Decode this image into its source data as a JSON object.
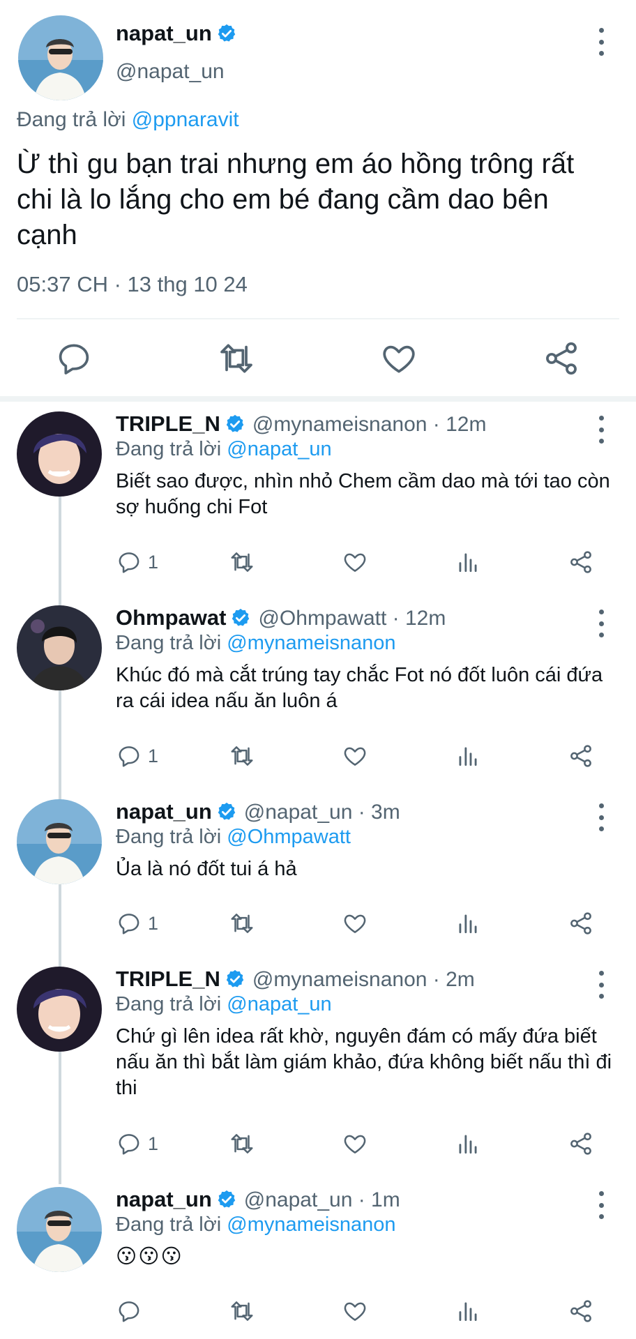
{
  "main_tweet": {
    "name": "napat_un",
    "handle": "@napat_un",
    "reply_prefix": "Đang trả lời",
    "reply_to": "@ppnaravit",
    "text": "Ừ thì gu bạn trai nhưng em áo hồng trông rất chi là lo lắng cho em bé đang cầm dao bên cạnh",
    "timestamp": "05:37 CH · 13 thg 10 24"
  },
  "colors": {
    "accent": "#1d9bf0",
    "text": "#0f1419",
    "muted": "#536471",
    "divider": "#eff3f4"
  },
  "icons": [
    "reply-icon",
    "retweet-icon",
    "like-icon",
    "share-icon",
    "analytics-icon",
    "verified-icon",
    "more-icon"
  ],
  "replies": [
    {
      "name": "TRIPLE_N",
      "handle": "@mynameisnanon · 12m",
      "reply_prefix": "Đang trả lời",
      "reply_to": "@napat_un",
      "text": "Biết sao được, nhìn nhỏ Chem cầm dao mà tới tao còn sợ huống chi Fot",
      "reply_count": "1"
    },
    {
      "name": "Ohmpawat",
      "handle": "@Ohmpawatt · 12m",
      "reply_prefix": "Đang trả lời",
      "reply_to": "@mynameisnanon",
      "text": "Khúc đó mà cắt trúng tay chắc Fot nó đốt luôn cái đứa ra cái idea nấu ăn luôn á",
      "reply_count": "1"
    },
    {
      "name": "napat_un",
      "handle": "@napat_un · 3m",
      "reply_prefix": "Đang trả lời",
      "reply_to": "@Ohmpawatt",
      "text": "Ủa là nó đốt tui á hả",
      "reply_count": "1"
    },
    {
      "name": "TRIPLE_N",
      "handle": "@mynameisnanon · 2m",
      "reply_prefix": "Đang trả lời",
      "reply_to": "@napat_un",
      "text": "Chứ gì lên idea rất khờ, nguyên đám có mấy đứa biết nấu ăn thì bắt làm giám khảo, đứa không biết nấu thì đi thi",
      "reply_count": "1"
    },
    {
      "name": "napat_un",
      "handle": "@napat_un · 1m",
      "reply_prefix": "Đang trả lời",
      "reply_to": "@mynameisnanon",
      "text": "😗😗😗",
      "reply_count": ""
    }
  ]
}
